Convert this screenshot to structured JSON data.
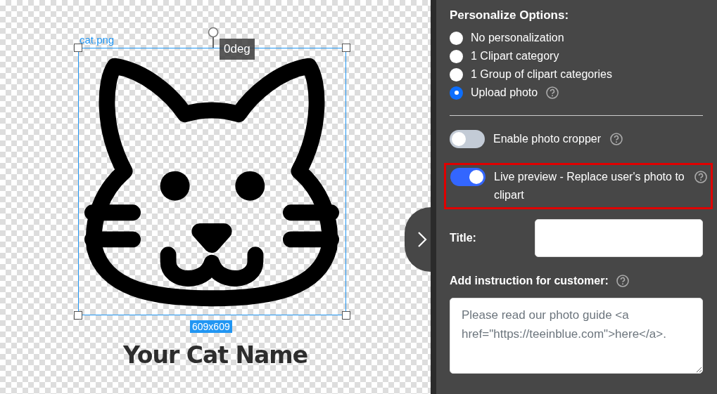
{
  "canvas": {
    "layer": {
      "filename": "cat.png",
      "rotation": "0deg",
      "size": "609x609",
      "selected": true
    },
    "caption": "Your Cat Name"
  },
  "panel": {
    "options_title": "Personalize Options:",
    "options": [
      {
        "label": "No personalization",
        "selected": false,
        "help": false
      },
      {
        "label": "1 Clipart category",
        "selected": false,
        "help": false
      },
      {
        "label": "1 Group of clipart categories",
        "selected": false,
        "help": false
      },
      {
        "label": "Upload photo",
        "selected": true,
        "help": true
      }
    ],
    "toggles": [
      {
        "label": "Enable photo cropper",
        "on": false,
        "highlighted": false
      },
      {
        "label": "Live preview - Replace user's photo to clipart",
        "on": true,
        "highlighted": true
      }
    ],
    "title_label": "Title:",
    "instruction_label": "Add instruction for customer:",
    "instruction_placeholder": "Please read our photo guide <a href=\"https://teeinblue.com\">here</a>."
  }
}
